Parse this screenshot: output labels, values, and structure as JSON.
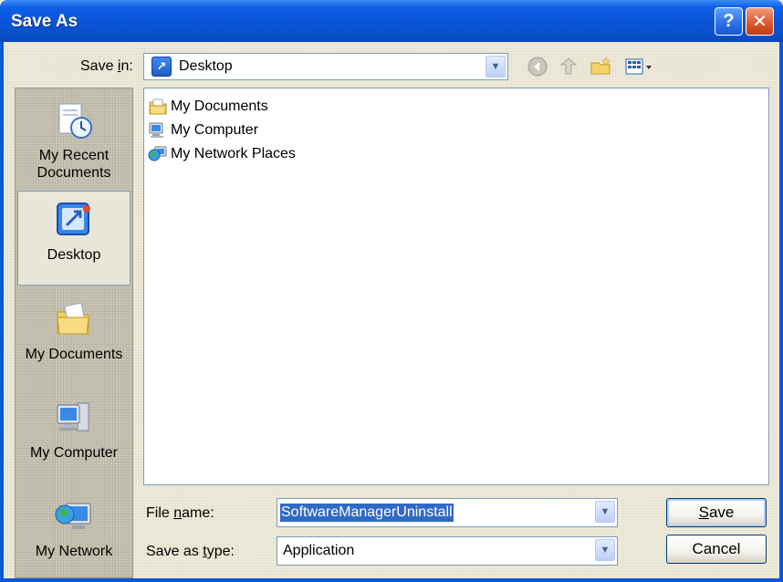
{
  "window": {
    "title": "Save As",
    "help_label": "?",
    "close_label": "✕"
  },
  "save_in": {
    "label_pre": "Save ",
    "label_ul": "i",
    "label_post": "n:",
    "value": "Desktop"
  },
  "toolbar": {
    "back_icon": "back-icon",
    "up_icon": "up-folder-icon",
    "new_folder_icon": "new-folder-icon",
    "views_icon": "views-menu-icon"
  },
  "places": [
    {
      "label": "My Recent Documents",
      "icon": "recent-documents-icon",
      "selected": false
    },
    {
      "label": "Desktop",
      "icon": "desktop-icon",
      "selected": true
    },
    {
      "label": "My Documents",
      "icon": "my-documents-icon",
      "selected": false
    },
    {
      "label": "My Computer",
      "icon": "my-computer-icon",
      "selected": false
    },
    {
      "label": "My Network",
      "icon": "my-network-icon",
      "selected": false
    }
  ],
  "files": [
    {
      "name": "My Documents",
      "icon": "folder-documents-icon"
    },
    {
      "name": "My Computer",
      "icon": "computer-icon"
    },
    {
      "name": "My Network Places",
      "icon": "network-places-icon"
    }
  ],
  "file_name": {
    "label_pre": "File ",
    "label_ul": "n",
    "label_post": "ame:",
    "value": "SoftwareManagerUninstall"
  },
  "save_as_type": {
    "label_pre": "Save as ",
    "label_ul": "t",
    "label_post": "ype:",
    "value": "Application"
  },
  "buttons": {
    "save_ul": "S",
    "save_rest": "ave",
    "cancel": "Cancel"
  },
  "colors": {
    "title_blue": "#0a54d6",
    "selection": "#316ac5",
    "dialog_bg": "#ece9d8"
  }
}
